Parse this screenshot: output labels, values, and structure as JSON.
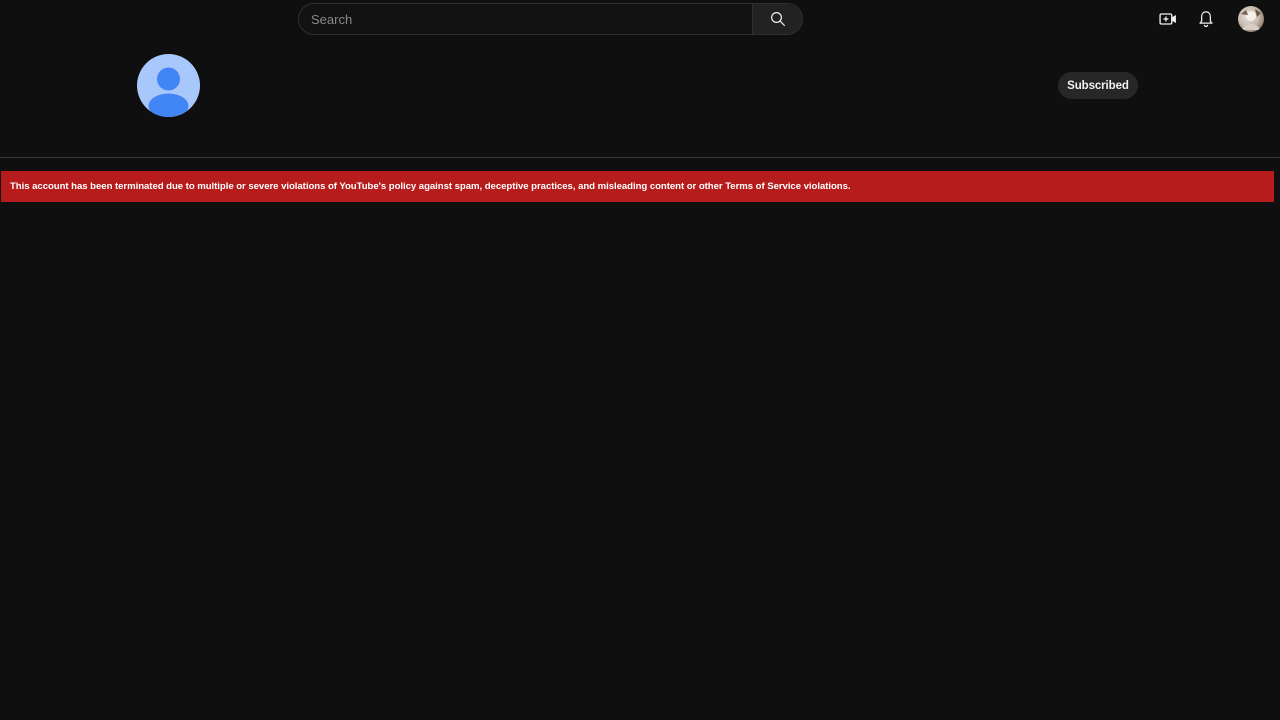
{
  "search": {
    "placeholder": "Search",
    "icon": "search-icon"
  },
  "header_icons": {
    "create": "video-create-icon",
    "notifications": "bell-icon",
    "account": "account-avatar"
  },
  "channel": {
    "avatar_icon": "default-person-avatar-icon",
    "subscribe_label": "Subscribed"
  },
  "alert": {
    "message": "This account has been terminated due to multiple or severe violations of YouTube's policy against spam, deceptive practices, and misleading content or other Terms of Service violations."
  },
  "colors": {
    "background": "#0f0f0f",
    "alert_background": "#b71c1c",
    "avatar_light": "#a8c7fa",
    "avatar_dark": "#4285f4",
    "chip_background": "#272727"
  }
}
